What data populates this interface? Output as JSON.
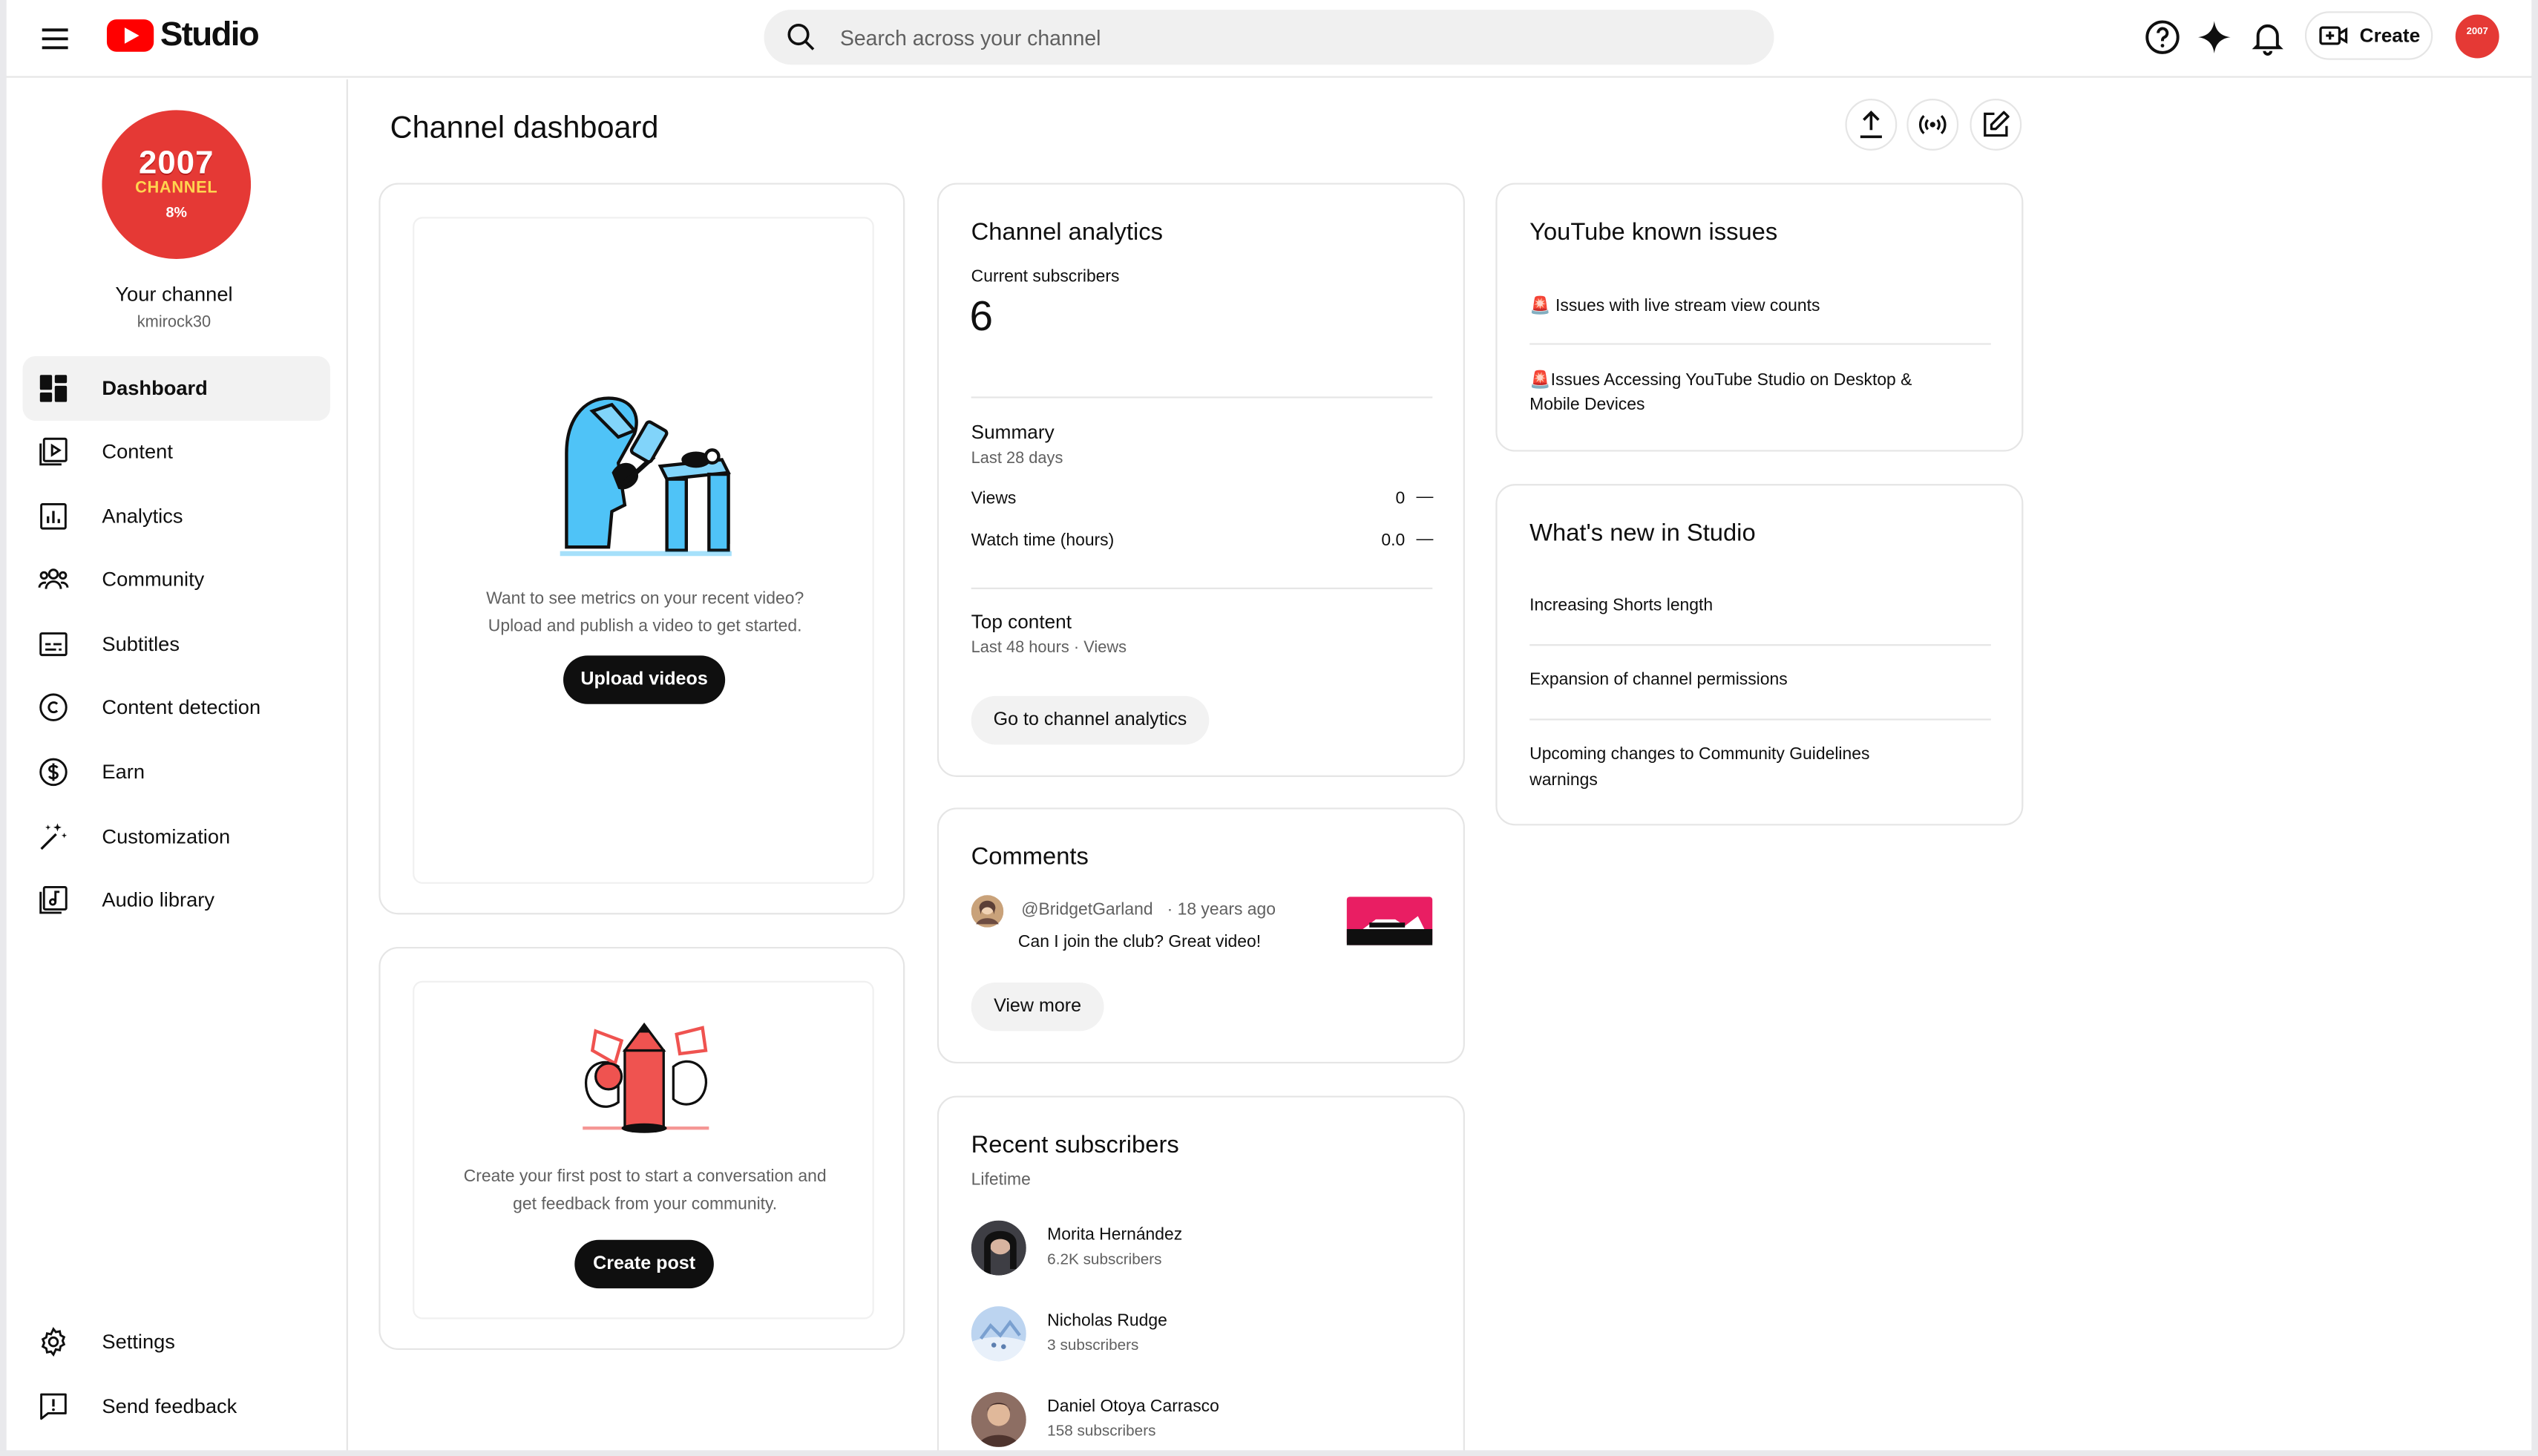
{
  "header": {
    "app_name": "Studio",
    "search_placeholder": "Search across your channel",
    "create_label": "Create",
    "avatar_text": "2007"
  },
  "sidebar": {
    "channel_avatar": {
      "line1": "2007",
      "line2": "CHANNEL",
      "line3": "8%"
    },
    "channel_name": "Your channel",
    "channel_handle": "kmirock30",
    "items": [
      {
        "label": "Dashboard",
        "icon": "dashboard-icon",
        "active": true
      },
      {
        "label": "Content",
        "icon": "content-icon"
      },
      {
        "label": "Analytics",
        "icon": "analytics-icon"
      },
      {
        "label": "Community",
        "icon": "community-icon"
      },
      {
        "label": "Subtitles",
        "icon": "subtitles-icon"
      },
      {
        "label": "Content detection",
        "icon": "copyright-icon"
      },
      {
        "label": "Earn",
        "icon": "dollar-icon"
      },
      {
        "label": "Customization",
        "icon": "magic-wand-icon"
      },
      {
        "label": "Audio library",
        "icon": "audio-library-icon"
      }
    ],
    "footer": [
      {
        "label": "Settings",
        "icon": "gear-icon"
      },
      {
        "label": "Send feedback",
        "icon": "feedback-icon"
      }
    ]
  },
  "main": {
    "title": "Channel dashboard",
    "upload_card": {
      "text_line1": "Want to see metrics on your recent video?",
      "text_line2": "Upload and publish a video to get started.",
      "button": "Upload videos"
    },
    "post_card": {
      "text_line1": "Create your first post to start a conversation and",
      "text_line2": "get feedback from your community.",
      "button": "Create post"
    },
    "analytics": {
      "title": "Channel analytics",
      "subscribers_label": "Current subscribers",
      "subscribers_value": "6",
      "summary_title": "Summary",
      "summary_period": "Last 28 days",
      "rows": [
        {
          "label": "Views",
          "value": "0",
          "trend": "—"
        },
        {
          "label": "Watch time (hours)",
          "value": "0.0",
          "trend": "—"
        }
      ],
      "top_content_title": "Top content",
      "top_content_period": "Last 48 hours · Views",
      "button": "Go to channel analytics"
    },
    "comments": {
      "title": "Comments",
      "items": [
        {
          "author": "@BridgetGarland",
          "time": "· 18 years ago",
          "text": "Can I join the club? Great video!"
        }
      ],
      "button": "View more"
    },
    "recent_subscribers": {
      "title": "Recent subscribers",
      "period": "Lifetime",
      "items": [
        {
          "name": "Morita Hernández",
          "count": "6.2K subscribers"
        },
        {
          "name": "Nicholas Rudge",
          "count": "3 subscribers"
        },
        {
          "name": "Daniel Otoya Carrasco",
          "count": "158 subscribers"
        }
      ]
    },
    "known_issues": {
      "title": "YouTube known issues",
      "items": [
        {
          "line1": "🚨 Issues with live stream view counts"
        },
        {
          "line1": "🚨Issues Accessing YouTube Studio on Desktop &",
          "line2": "Mobile Devices"
        }
      ]
    },
    "whats_new": {
      "title": "What's new in Studio",
      "items": [
        {
          "line1": "Increasing Shorts length"
        },
        {
          "line1": "Expansion of channel permissions"
        },
        {
          "line1": "Upcoming changes to Community Guidelines",
          "line2": "warnings"
        }
      ]
    }
  },
  "colors": {
    "brand_red": "#ff0000",
    "avatar_red": "#e53935",
    "text_primary": "#0f0f0f",
    "text_secondary": "#606060",
    "illustration_blue": "#4fc3f7",
    "illustration_red": "#ef5350"
  }
}
